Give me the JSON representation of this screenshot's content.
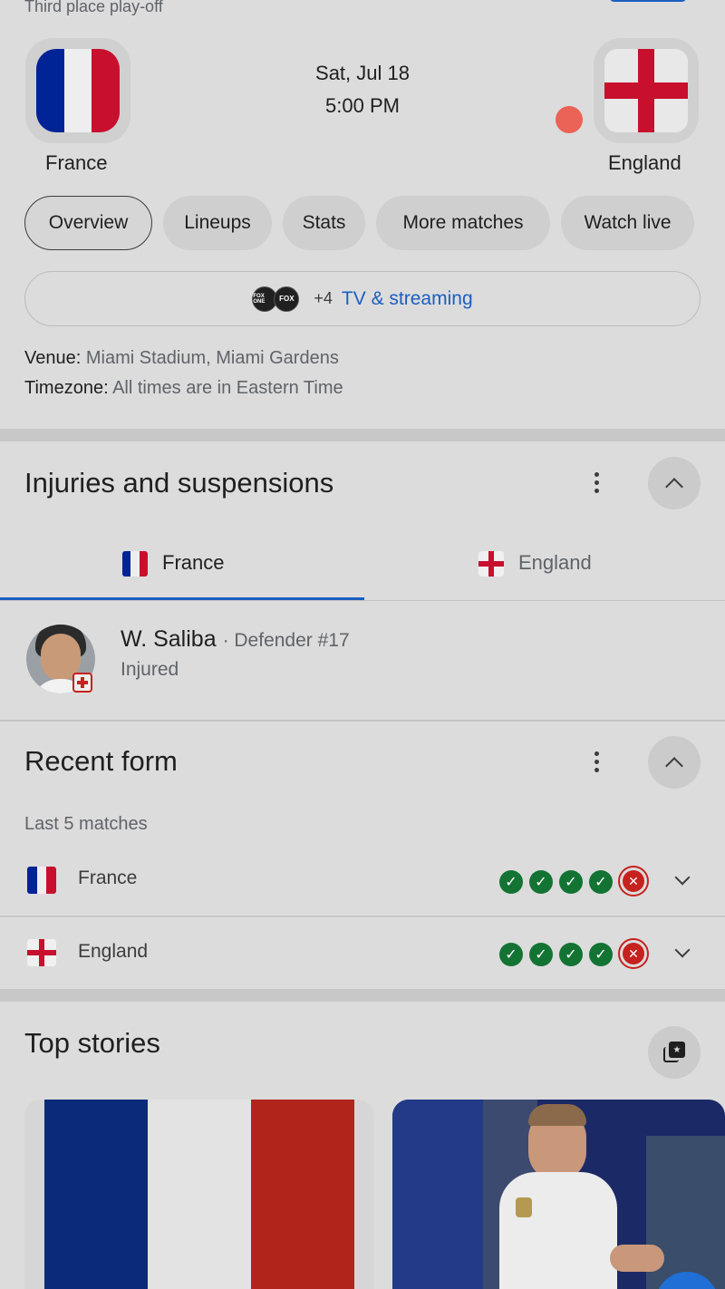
{
  "match": {
    "stage": "Third place play-off",
    "date": "Sat, Jul 18",
    "time": "5:00 PM",
    "home_team": "France",
    "away_team": "England"
  },
  "tabs": [
    {
      "label": "Overview",
      "active": true
    },
    {
      "label": "Lineups"
    },
    {
      "label": "Stats"
    },
    {
      "label": "More matches"
    },
    {
      "label": "Watch live"
    }
  ],
  "tv": {
    "channel_logos": [
      "FOX ONE",
      "FOX"
    ],
    "extra_count": "+4",
    "link_label": "TV & streaming"
  },
  "info": {
    "venue_label": "Venue:",
    "venue_value": "Miami Stadium, Miami Gardens",
    "timezone_label": "Timezone:",
    "timezone_value": "All times are in Eastern Time"
  },
  "injuries": {
    "title": "Injuries and suspensions",
    "team_tabs": [
      "France",
      "England"
    ],
    "player": {
      "name": "W. Saliba",
      "detail": "· Defender #17",
      "status": "Injured"
    }
  },
  "recent_form": {
    "title": "Recent form",
    "subtitle": "Last 5 matches",
    "teams": [
      {
        "name": "France",
        "results": [
          "W",
          "W",
          "W",
          "W",
          "L"
        ]
      },
      {
        "name": "England",
        "results": [
          "W",
          "W",
          "W",
          "W",
          "L"
        ]
      }
    ]
  },
  "top_stories": {
    "title": "Top stories"
  },
  "colors": {
    "accent_blue": "#1a5fbf",
    "win_green": "#137333",
    "loss_red": "#c5221f",
    "france_blue": "#002395",
    "france_red": "#c8102e"
  }
}
